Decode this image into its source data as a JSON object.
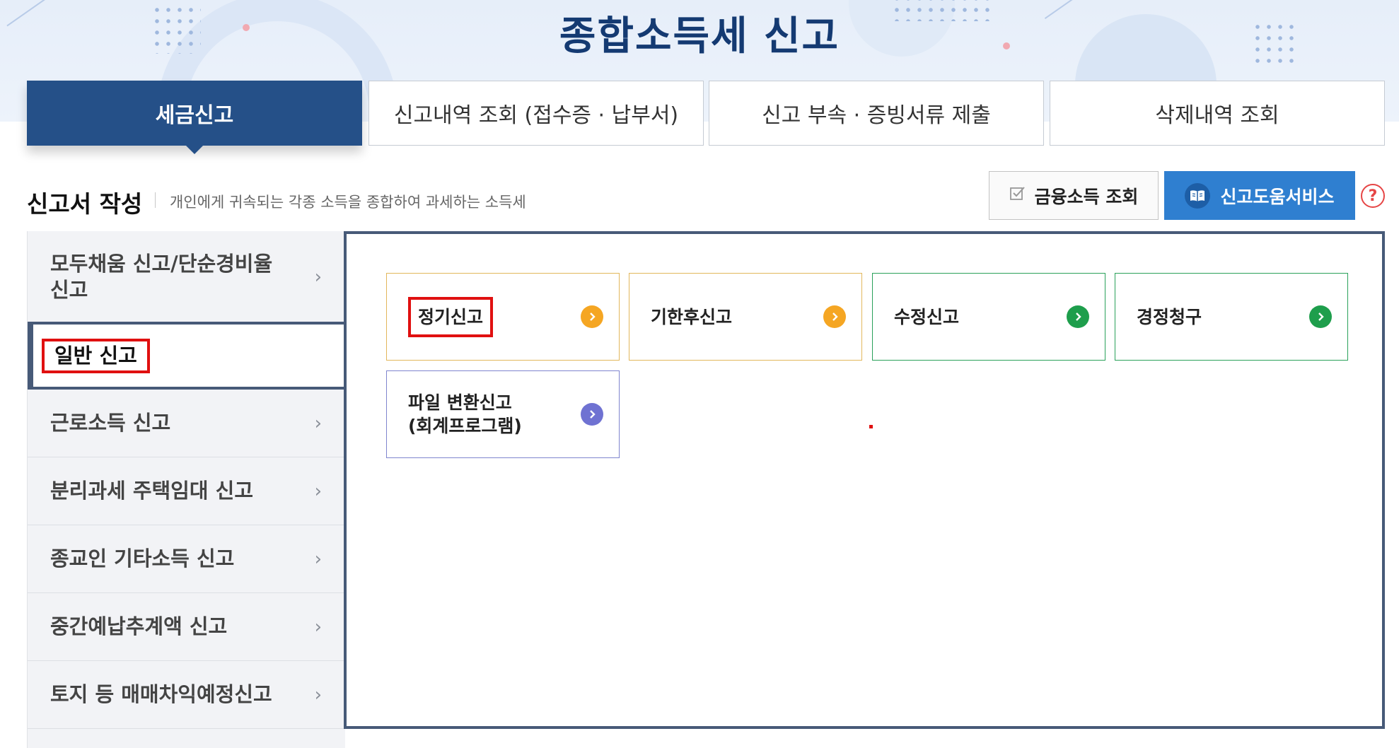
{
  "page": {
    "title": "종합소득세 신고"
  },
  "tabs": [
    {
      "label": "세금신고",
      "active": true
    },
    {
      "label": "신고내역 조회 (접수증 · 납부서)",
      "active": false
    },
    {
      "label": "신고 부속 · 증빙서류 제출",
      "active": false
    },
    {
      "label": "삭제내역 조회",
      "active": false
    }
  ],
  "section": {
    "title": "신고서 작성",
    "description": "개인에게 귀속되는 각종 소득을 종합하여 과세하는 소득세"
  },
  "actions": {
    "financial_income": {
      "label": "금융소득 조회",
      "icon": "checkbox-edit-icon"
    },
    "help_service": {
      "label": "신고도움서비스",
      "icon": "book-icon"
    },
    "help_question": {
      "glyph": "?"
    }
  },
  "sidebar": {
    "items": [
      {
        "label": "모두채움 신고/단순경비율 신고",
        "line1": "모두채움 신고/단순경비율",
        "line2": "신고",
        "active": false
      },
      {
        "label": "일반 신고",
        "active": true
      },
      {
        "label": "근로소득 신고",
        "active": false
      },
      {
        "label": "분리과세 주택임대 신고",
        "active": false
      },
      {
        "label": "종교인 기타소득 신고",
        "active": false
      },
      {
        "label": "중간예납추계액 신고",
        "active": false
      },
      {
        "label": "토지 등 매매차익예정신고",
        "active": false
      }
    ],
    "chevron": "›"
  },
  "cards": [
    {
      "label": "정기신고",
      "color": "#f5a623",
      "highlighted": true
    },
    {
      "label": "기한후신고",
      "color": "#f5a623",
      "highlighted": false
    },
    {
      "label": "수정신고",
      "color": "#1e9e4c",
      "highlighted": false
    },
    {
      "label": "경정청구",
      "color": "#1e9e4c",
      "highlighted": false
    },
    {
      "label": "파일 변환신고 (회계프로그램)",
      "line1": "파일 변환신고",
      "line2": "(회계프로그램)",
      "color": "#6f72d2",
      "highlighted": false
    }
  ],
  "colors": {
    "primary": "#255088",
    "panel_border": "#475a78",
    "help_button": "#2f7fd0",
    "highlight": "#e01010"
  }
}
